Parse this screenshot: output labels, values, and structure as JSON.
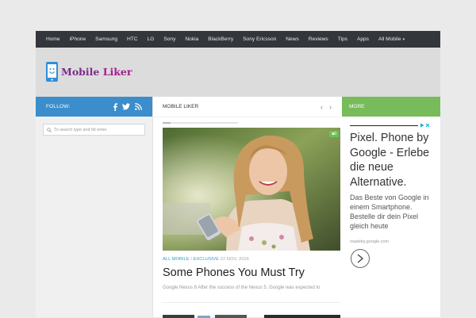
{
  "nav": {
    "items": [
      {
        "label": "Home"
      },
      {
        "label": "iPhone"
      },
      {
        "label": "Samsung"
      },
      {
        "label": "HTC"
      },
      {
        "label": "LG"
      },
      {
        "label": "Sony"
      },
      {
        "label": "Nokia"
      },
      {
        "label": "BlackBerry"
      },
      {
        "label": "Sony Ericsson"
      },
      {
        "label": "News"
      },
      {
        "label": "Reviews"
      },
      {
        "label": "Tips"
      },
      {
        "label": "Apps"
      },
      {
        "label": "All Mobile"
      }
    ]
  },
  "logo": {
    "word1": "Mobile",
    "word2": "Liker"
  },
  "sidebar": {
    "follow_label": "FOLLOW:",
    "social_icons": [
      "facebook-icon",
      "twitter-icon",
      "rss-icon"
    ],
    "search_placeholder": "To search type and hit enter"
  },
  "main": {
    "section_title": "MOBILE LIKER",
    "slider_progress": 0.1,
    "article": {
      "category1": "ALL MOBILE",
      "separator": "/",
      "category2": "EXCLUSIVE",
      "date": "22 NOV, 2016",
      "title": "Some Phones You Must Try",
      "excerpt": "Google Nexus 6 After the success of the Nexus 5, Google was expected to"
    }
  },
  "right": {
    "more_label": "MORE",
    "ad": {
      "headline": "Pixel. Phone by Google - Erlebe die neue Alternative.",
      "body": "Das Beste von Google in einem Smartphone. Bestelle dir dein Pixel gleich heute",
      "url": "madeby.google.com"
    }
  },
  "colors": {
    "nav_bg": "#33363b",
    "follow_bar": "#3b8dcb",
    "more_bar": "#77bb5b",
    "category_link": "#2b9ed6",
    "logo_text": "#7d2a8c"
  }
}
